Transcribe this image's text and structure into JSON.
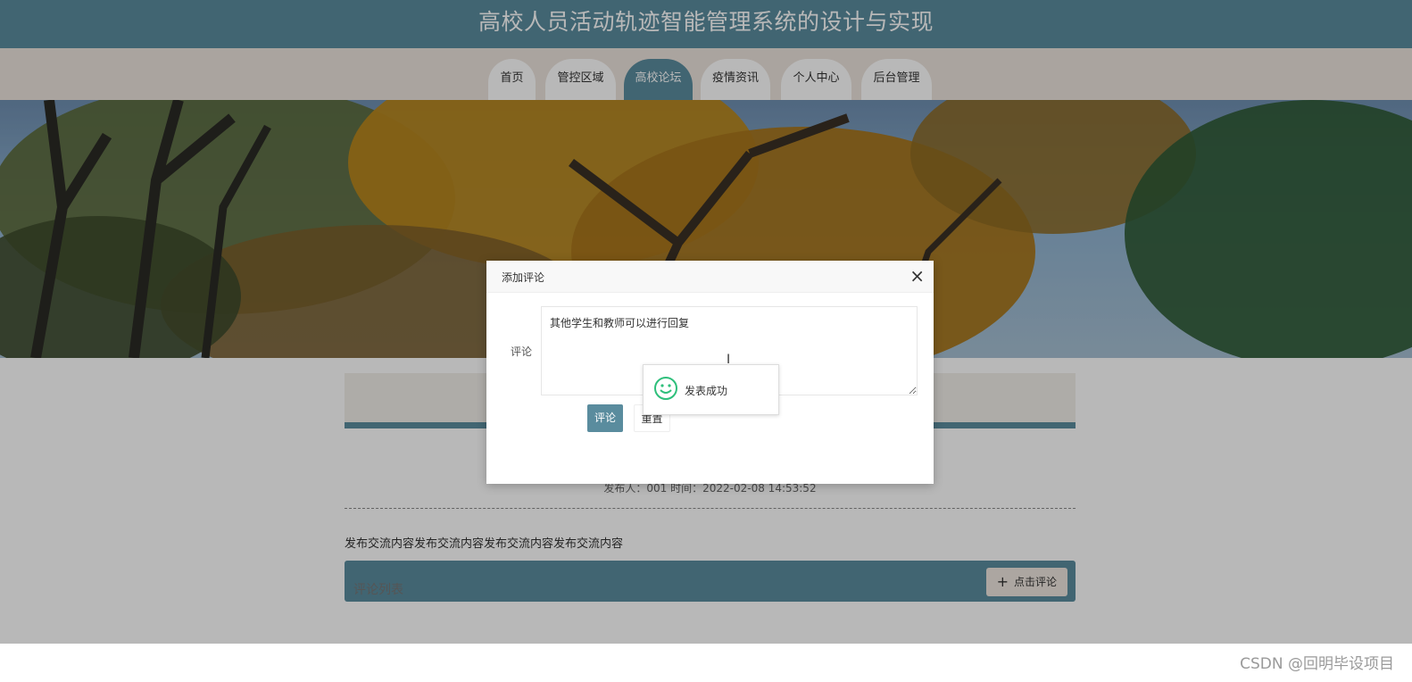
{
  "header": {
    "title": "高校人员活动轨迹智能管理系统的设计与实现"
  },
  "nav": {
    "items": [
      {
        "label": "首页"
      },
      {
        "label": "管控区域"
      },
      {
        "label": "高校论坛"
      },
      {
        "label": "疫情资讯"
      },
      {
        "label": "个人中心"
      },
      {
        "label": "后台管理"
      }
    ],
    "active_index": 2
  },
  "post": {
    "meta": "发布人：001 时间：2022-02-08 14:53:52",
    "body": "发布交流内容发布交流内容发布交流内容发布交流内容",
    "comments_title": "评论列表",
    "comment_button": "点击评论"
  },
  "dialog": {
    "title": "添加评论",
    "field_label": "评论",
    "textarea_value": "其他学生和教师可以进行回复",
    "submit_label": "评论",
    "reset_label": "重置"
  },
  "toast": {
    "message": "发表成功"
  },
  "watermark": "CSDN @回明毕设项目",
  "colors": {
    "header_bg": "#5a8c9e",
    "nav_bg": "#ece4dd",
    "accent": "#5a8c9e",
    "success": "#2ebf7b"
  }
}
